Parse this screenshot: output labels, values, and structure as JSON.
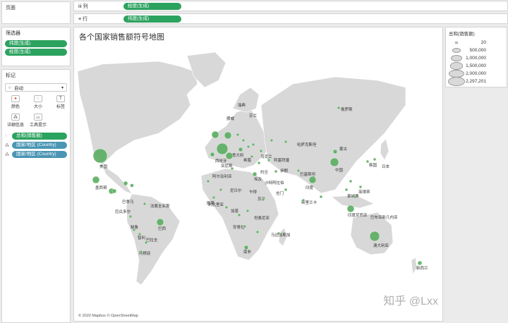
{
  "shelves": {
    "pages_label": "页面",
    "filters_label": "筛选器",
    "marks_label": "标记",
    "columns_label": "列",
    "rows_label": "行",
    "column_field": "经度(生成)",
    "row_field": "纬度(生成)"
  },
  "filters": [
    "纬度(生成)",
    "经度(生成)"
  ],
  "marks": {
    "type": "自动",
    "cards": [
      "颜色",
      "大小",
      "标签",
      "详细信息",
      "工具提示"
    ],
    "fields": [
      "总和(销售额)",
      "国家/地区 (Country)",
      "国家/地区 (Country)"
    ]
  },
  "view": {
    "title": "各个国家销售额符号地图",
    "attribution": "© 2020 Mapbox © OpenStreetMap",
    "watermark": "知乎 @Lxx"
  },
  "legend": {
    "title": "总和(销售额)",
    "items": [
      "20",
      "500,000",
      "1,000,000",
      "1,500,000",
      "2,000,000",
      "2,297,201"
    ]
  },
  "colors": {
    "mark": "#5aae61",
    "pill_green": "#2ca25f",
    "pill_blue": "#4a96b4",
    "land": "#d8d8d8",
    "water": "#ffffff"
  },
  "map": {
    "country_labels": [
      "芬兰",
      "瑞典",
      "挪威",
      "俄罗斯",
      "哈萨克斯坦",
      "蒙古",
      "中国",
      "韩国",
      "日本",
      "美国",
      "墨西哥",
      "乌克兰",
      "意大利",
      "西班牙",
      "突尼斯",
      "希腊",
      "阿塞拜疆",
      "伊朗",
      "约旦",
      "埃及",
      "沙特阿拉伯",
      "也门",
      "阿尔及利亚",
      "尼日尔",
      "乍得",
      "苏丹",
      "刚果",
      "利比里亚",
      "加蓬",
      "坦桑尼亚",
      "安哥拉",
      "马达加斯加",
      "南非",
      "巴基斯坦",
      "印度",
      "斯里兰卡",
      "菲律宾",
      "柬埔寨",
      "印度尼西亚",
      "巴布亚新几内亚",
      "澳大利亚",
      "新西兰",
      "巴拿马",
      "厄瓜多尔",
      "法属圭亚那",
      "秘鲁",
      "巴西",
      "智利",
      "巴拉圭",
      "阿根廷"
    ]
  }
}
